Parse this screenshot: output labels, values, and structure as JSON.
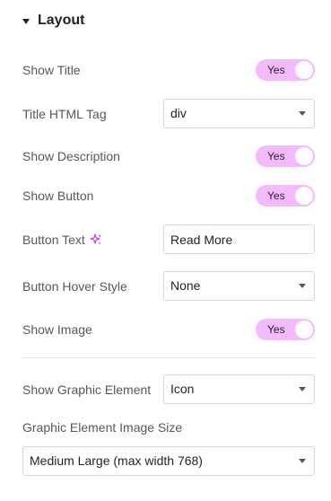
{
  "section": {
    "title": "Layout"
  },
  "controls": {
    "show_title": {
      "label": "Show Title",
      "toggle_text": "Yes",
      "checked": true
    },
    "title_html_tag": {
      "label": "Title HTML Tag",
      "value": "div"
    },
    "show_description": {
      "label": "Show Description",
      "toggle_text": "Yes",
      "checked": true
    },
    "show_button": {
      "label": "Show Button",
      "toggle_text": "Yes",
      "checked": true
    },
    "button_text": {
      "label": "Button Text",
      "value": "Read More",
      "ai_icon": "sparkle-icon",
      "dynamic_icon": "database-icon"
    },
    "button_hover_style": {
      "label": "Button Hover Style",
      "value": "None"
    },
    "show_image": {
      "label": "Show Image",
      "toggle_text": "Yes",
      "checked": true
    },
    "show_graphic_element": {
      "label": "Show Graphic Element",
      "value": "Icon"
    },
    "graphic_element_image_size": {
      "label": "Graphic Element Image Size",
      "value": "Medium Large (max width 768)"
    }
  },
  "colors": {
    "toggle_on": "#f3bafd",
    "ai_accent": "#c036e0",
    "label": "#515962",
    "text": "#1f2124",
    "border": "#d5d8dc"
  }
}
